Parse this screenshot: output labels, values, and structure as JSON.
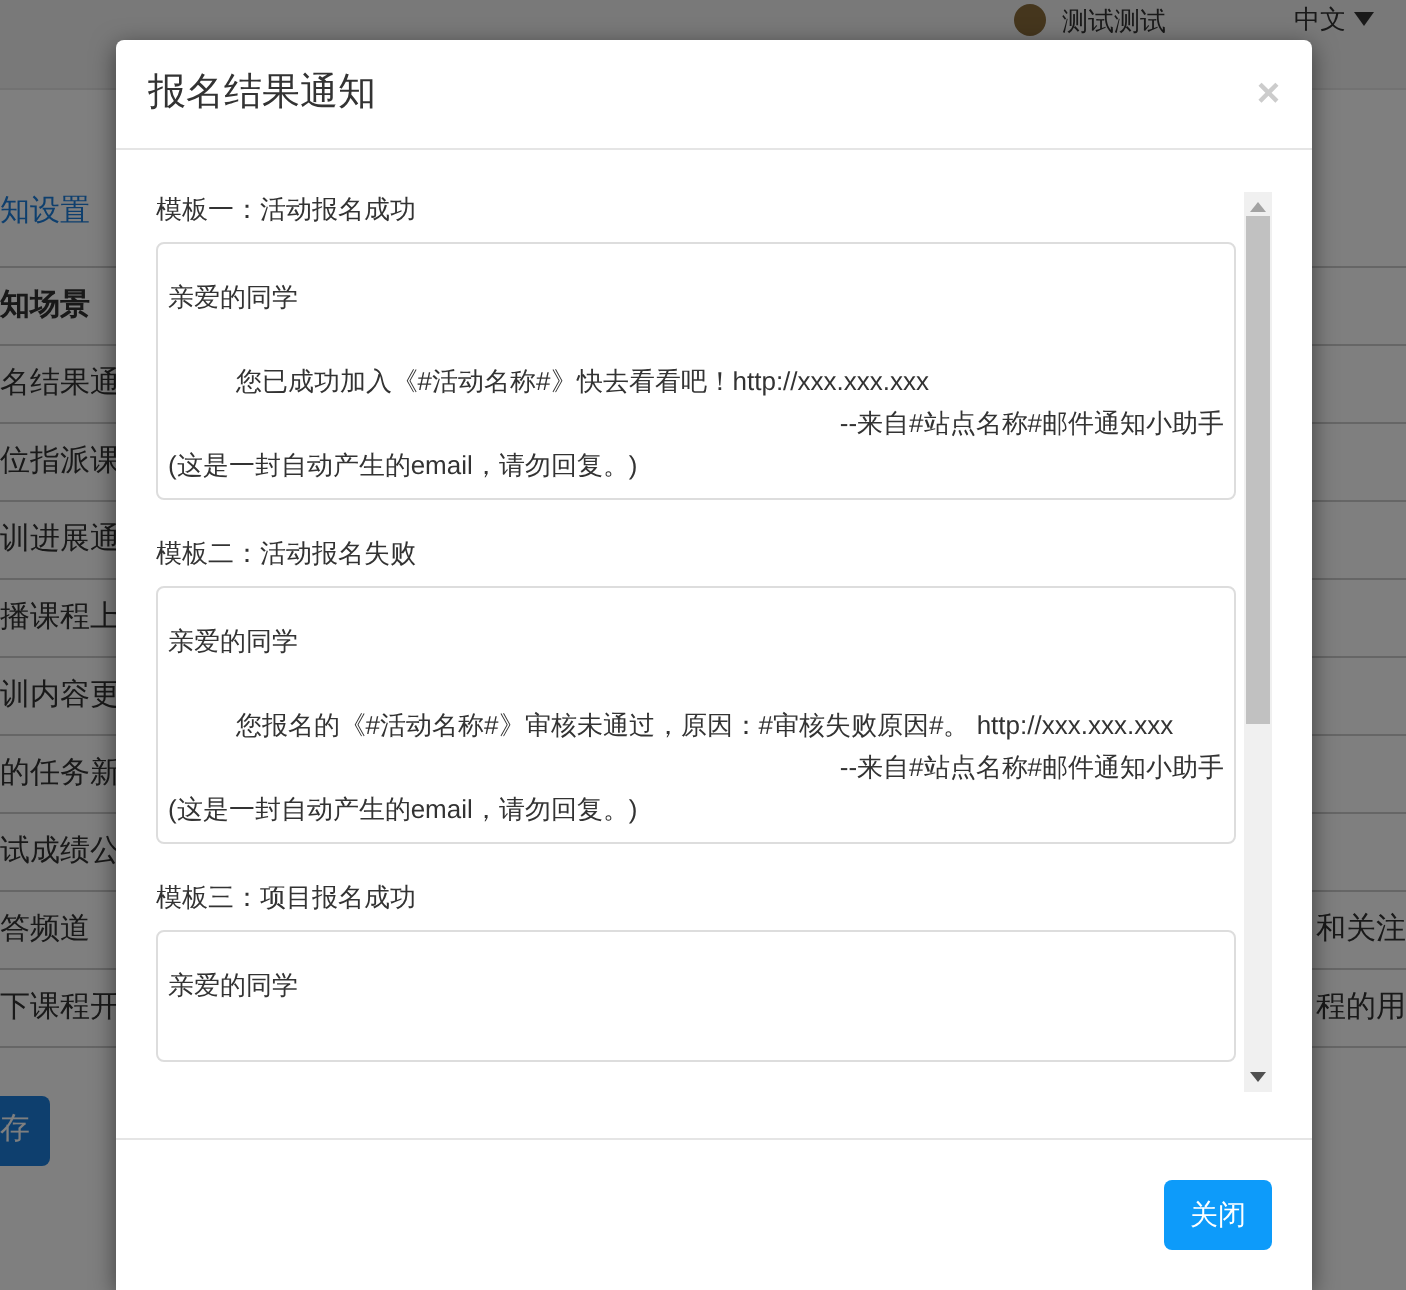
{
  "header": {
    "username": "测试测试",
    "language": "中文"
  },
  "page": {
    "section_link": "知设置",
    "table_header": "知场景",
    "rows": [
      {
        "left": "名结果通"
      },
      {
        "left": "位指派课"
      },
      {
        "left": "训进展通"
      },
      {
        "left": "播课程上"
      },
      {
        "left": "训内容更"
      },
      {
        "left": "的任务新"
      },
      {
        "left": "试成绩公"
      },
      {
        "left": "答频道",
        "right": "和关注"
      },
      {
        "left": "下课程开",
        "right": "程的用"
      }
    ],
    "save_button": "存"
  },
  "modal": {
    "title": "报名结果通知",
    "close": "×",
    "templates": [
      {
        "label": "模板一：活动报名成功",
        "greeting": "亲爱的同学",
        "body": "您已成功加入《#活动名称#》快去看看吧！http://xxx.xxx.xxx",
        "signature": "--来自#站点名称#邮件通知小助手",
        "note": "(这是一封自动产生的email，请勿回复。)"
      },
      {
        "label": "模板二：活动报名失败",
        "greeting": "亲爱的同学",
        "body": "您报名的《#活动名称#》审核未通过，原因：#审核失败原因#。 http://xxx.xxx.xxx",
        "signature": "--来自#站点名称#邮件通知小助手",
        "note": "(这是一封自动产生的email，请勿回复。)"
      },
      {
        "label": "模板三：项目报名成功",
        "greeting": "亲爱的同学"
      }
    ],
    "close_button": "关闭"
  }
}
